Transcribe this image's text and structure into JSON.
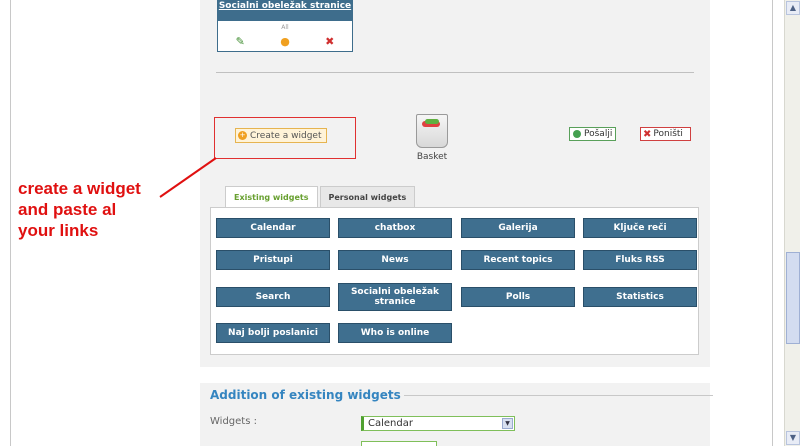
{
  "reference_card": {
    "title": "Socialni obeležak stranice",
    "subtitle": "All",
    "icons": [
      "edit-icon",
      "settings-icon",
      "delete-icon"
    ]
  },
  "actions": {
    "create_widget_label": "Create a widget",
    "basket_label": "Basket",
    "send_label": "Pošalji",
    "cancel_label": "Poništi"
  },
  "annotation": {
    "text": "create a widget and paste al your links",
    "color": "#e01010"
  },
  "tabs": [
    {
      "label": "Existing widgets",
      "active": true
    },
    {
      "label": "Personal widgets",
      "active": false
    }
  ],
  "widgets": [
    "Calendar",
    "chatbox",
    "Galerija",
    "Ključe reči",
    "Pristupi",
    "News",
    "Recent topics",
    "Fluks RSS",
    "Search",
    "Socialni obeležak stranice",
    "Polls",
    "Statistics",
    "Naj bolji poslanici",
    "Who is online"
  ],
  "addition_section": {
    "legend": "Addition of existing widgets",
    "widgets_label": "Widgets :",
    "selected_widget": "Calendar"
  },
  "colors": {
    "widget_button": "#3f6f8f",
    "accent_blue": "#3585c0",
    "active_tab_text": "#68a030"
  }
}
